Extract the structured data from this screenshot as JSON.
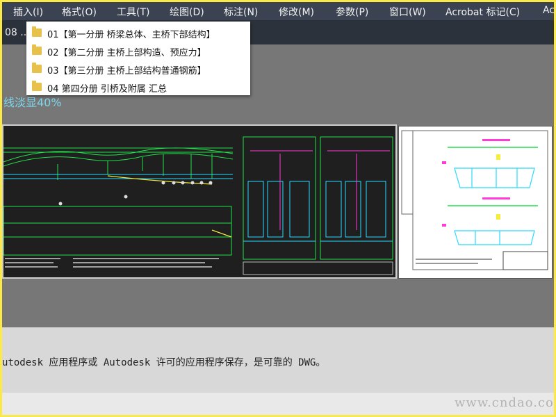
{
  "menu": {
    "items": [
      "插入(I)",
      "格式(O)",
      "工具(T)",
      "绘图(D)",
      "标注(N)",
      "修改(M)",
      "参数(P)",
      "窗口(W)",
      "Acrobat 标记(C)",
      "Ac"
    ]
  },
  "doc_tab": {
    "label": "08 ..."
  },
  "dropdown": {
    "items": [
      {
        "label": "01【第一分册  桥梁总体、主桥下部结构】"
      },
      {
        "label": "02【第二分册  主桥上部构造、预应力】"
      },
      {
        "label": "03【第三分册  主桥上部结构普通钢筋】"
      },
      {
        "label": "04  第四分册 引桥及附属 汇总"
      }
    ]
  },
  "background_text": "线淡显40%",
  "command_line": {
    "text": "utodesk 应用程序或 Autodesk 许可的应用程序保存，是可靠的 DWG。"
  },
  "watermark": {
    "text": "www.cndao.com"
  },
  "colors": {
    "menubar": "#3b4352",
    "frame": "#fbe94a",
    "canvas": "#1f1f1f",
    "drawing_green": "#22e04a",
    "drawing_cyan": "#29d9ff",
    "drawing_magenta": "#ff3bd8",
    "drawing_yellow": "#f5ec3c"
  }
}
